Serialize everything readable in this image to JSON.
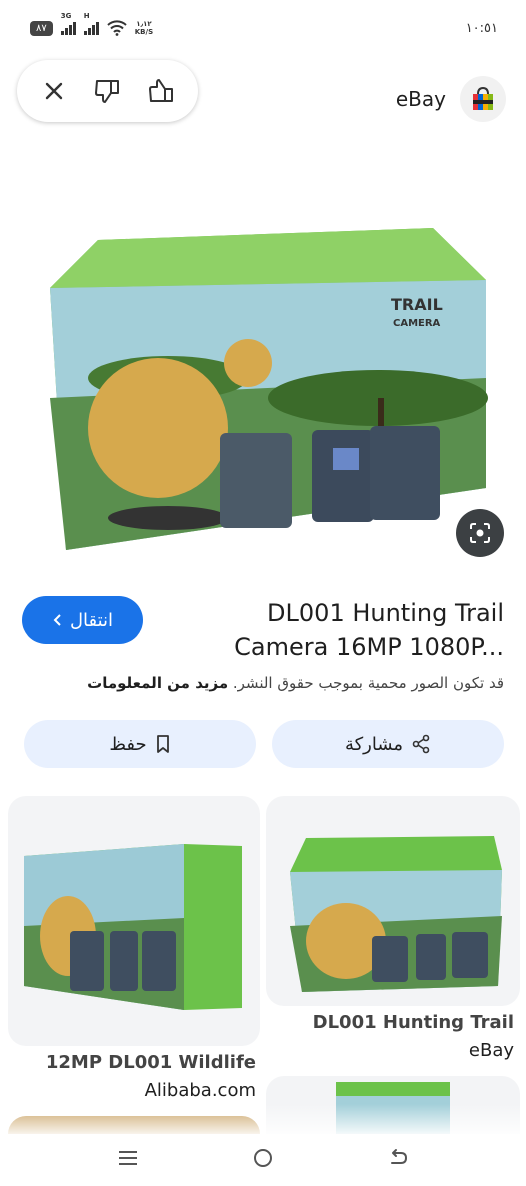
{
  "status_bar": {
    "battery": "٨٧",
    "signal1": "3G",
    "signal2": "H",
    "speed_value": "١٫١٢",
    "speed_unit": "KB/S",
    "time": "١٠:٥١"
  },
  "header": {
    "source_name": "eBay"
  },
  "result": {
    "title": "DL001 Hunting Trail Camera 16MP 1080P...",
    "visit_label": "انتقال",
    "copyright_text": "قد تكون الصور محمية بموجب حقوق النشر.",
    "more_info_label": "مزيد من المعلومات"
  },
  "actions": {
    "share_label": "مشاركة",
    "save_label": "حفظ"
  },
  "related": [
    {
      "title": "DL001 Hunting Trail",
      "source": "eBay"
    },
    {
      "title": "12MP DL001 Wildlife",
      "source": "Alibaba.com"
    }
  ],
  "image_text": {
    "brand_line1": "TRAIL",
    "brand_line2": "CAMERA"
  },
  "colors": {
    "accent": "#1a73e8",
    "action_bg": "#e8f0fe",
    "box_green": "#6cc24a"
  },
  "icons": [
    "close-icon",
    "thumbs-down-icon",
    "thumbs-up-icon",
    "shopping-bag-icon",
    "lens-icon",
    "chevron-left-icon",
    "share-icon",
    "bookmark-icon",
    "menu-icon",
    "home-icon",
    "back-icon"
  ]
}
